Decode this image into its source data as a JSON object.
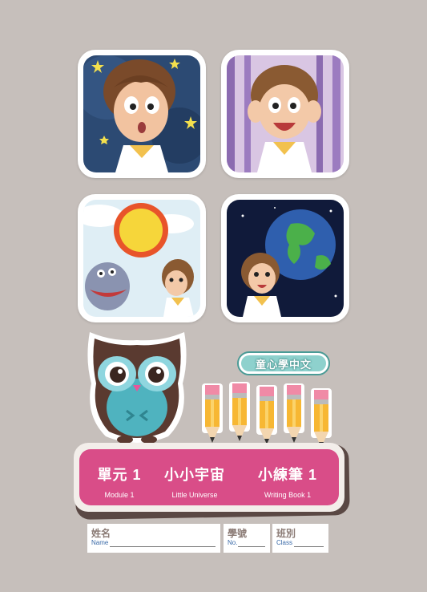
{
  "brand": "童心學中文",
  "banner": {
    "module_zh": "單元 1",
    "module_en": "Module 1",
    "title_zh": "小小宇宙",
    "title_en": "Little Universe",
    "book_zh": "小練筆 1",
    "book_en": "Writing Book 1"
  },
  "form": {
    "name_zh": "姓名",
    "name_en": "Name",
    "no_zh": "學號",
    "no_en": "No.",
    "class_zh": "班別",
    "class_en": "Class"
  },
  "colors": {
    "background": "#c6bfbb",
    "banner": "#d94d88",
    "brand_teal": "#8ed1cd",
    "owl_teal": "#4fb3bf",
    "owl_brown": "#5a3a30"
  },
  "illustrations": [
    "girl-surprised-stars",
    "girl-excited-purple-curtain",
    "sun-and-alien-with-girl",
    "earth-and-girl-in-space"
  ]
}
